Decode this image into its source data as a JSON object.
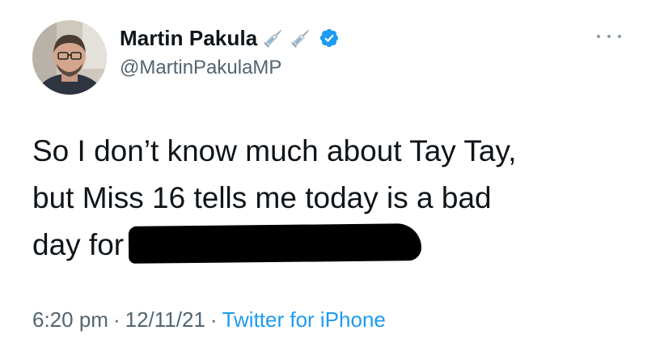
{
  "author": {
    "display_name": "Martin Pakula",
    "handle": "@MartinPakulaMP",
    "name_emojis": [
      "syringe-icon",
      "syringe-icon"
    ],
    "verified": true
  },
  "tweet": {
    "text_lines": [
      "So I don’t know much about Tay Tay,",
      "but Miss 16 tells me today is a bad",
      "day for"
    ],
    "redacted": true
  },
  "meta": {
    "time": "6:20 pm",
    "separator": "·",
    "date": "12/11/21",
    "source": "Twitter for iPhone"
  },
  "colors": {
    "text": "#0f1419",
    "secondary": "#536471",
    "link": "#1d9bf0",
    "verified": "#1d9bf0"
  }
}
